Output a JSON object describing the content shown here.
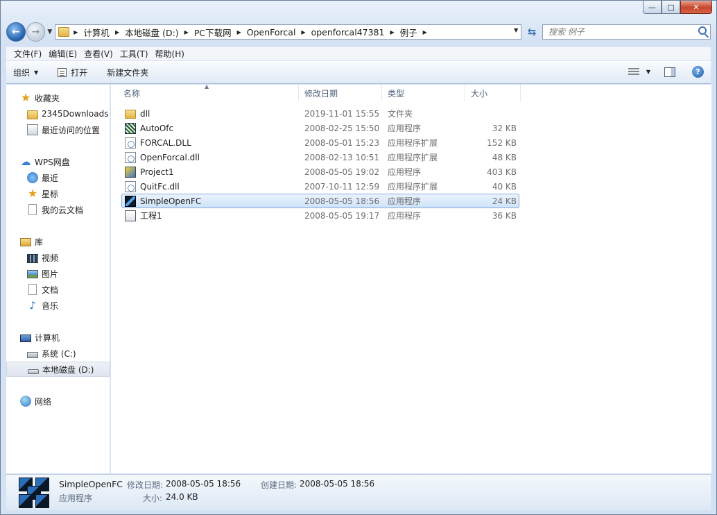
{
  "window": {
    "caption": {
      "minimize": "—",
      "maximize": "□",
      "close": "✕"
    }
  },
  "address": {
    "crumbs": [
      "计算机",
      "本地磁盘 (D:)",
      "PC下载网",
      "OpenForcal",
      "openforcal47381",
      "例子"
    ],
    "search_placeholder": "搜索 例子"
  },
  "menu": [
    "文件(F)",
    "编辑(E)",
    "查看(V)",
    "工具(T)",
    "帮助(H)"
  ],
  "toolbar": {
    "organize": "组织",
    "open": "打开",
    "new_folder": "新建文件夹"
  },
  "nav": {
    "favorites": "收藏夹",
    "downloads": "2345Downloads",
    "recent_places": "最近访问的位置",
    "wps": "WPS网盘",
    "recent": "最近",
    "starred": "星标",
    "my_cloud_docs": "我的云文档",
    "libraries": "库",
    "videos": "视频",
    "pictures": "图片",
    "documents": "文档",
    "music": "音乐",
    "computer": "计算机",
    "system_c": "系统 (C:)",
    "local_d": "本地磁盘 (D:)",
    "network": "网络"
  },
  "columns": {
    "name": "名称",
    "date": "修改日期",
    "type": "类型",
    "size": "大小"
  },
  "files": [
    {
      "name": "dll",
      "date": "2019-11-01 15:55",
      "type": "文件夹",
      "size": "",
      "icon": "folder-icon"
    },
    {
      "name": "AutoOfc",
      "date": "2008-02-25 15:50",
      "type": "应用程序",
      "size": "32 KB",
      "icon": "app-icon"
    },
    {
      "name": "FORCAL.DLL",
      "date": "2008-05-01 15:23",
      "type": "应用程序扩展",
      "size": "152 KB",
      "icon": "dll-icon"
    },
    {
      "name": "OpenForcal.dll",
      "date": "2008-02-13 10:51",
      "type": "应用程序扩展",
      "size": "48 KB",
      "icon": "dll-icon"
    },
    {
      "name": "Project1",
      "date": "2008-05-05 19:02",
      "type": "应用程序",
      "size": "403 KB",
      "icon": "vb-app-icon"
    },
    {
      "name": "QuitFc.dll",
      "date": "2007-10-11 12:59",
      "type": "应用程序扩展",
      "size": "40 KB",
      "icon": "dll-icon"
    },
    {
      "name": "SimpleOpenFC",
      "date": "2008-05-05 18:56",
      "type": "应用程序",
      "size": "24 KB",
      "icon": "cubes-app-icon"
    },
    {
      "name": "工程1",
      "date": "2008-05-05 19:17",
      "type": "应用程序",
      "size": "36 KB",
      "icon": "project-app-icon"
    }
  ],
  "selected_file": "SimpleOpenFC",
  "details": {
    "name": "SimpleOpenFC",
    "type": "应用程序",
    "modified_label": "修改日期:",
    "modified": "2008-05-05 18:56",
    "created_label": "创建日期:",
    "created": "2008-05-05 18:56",
    "size_label": "大小:",
    "size": "24.0 KB"
  },
  "colors": {
    "selection_bg": "#cfe3fa",
    "selection_border": "#84acdd",
    "header_text": "#4c607a"
  }
}
